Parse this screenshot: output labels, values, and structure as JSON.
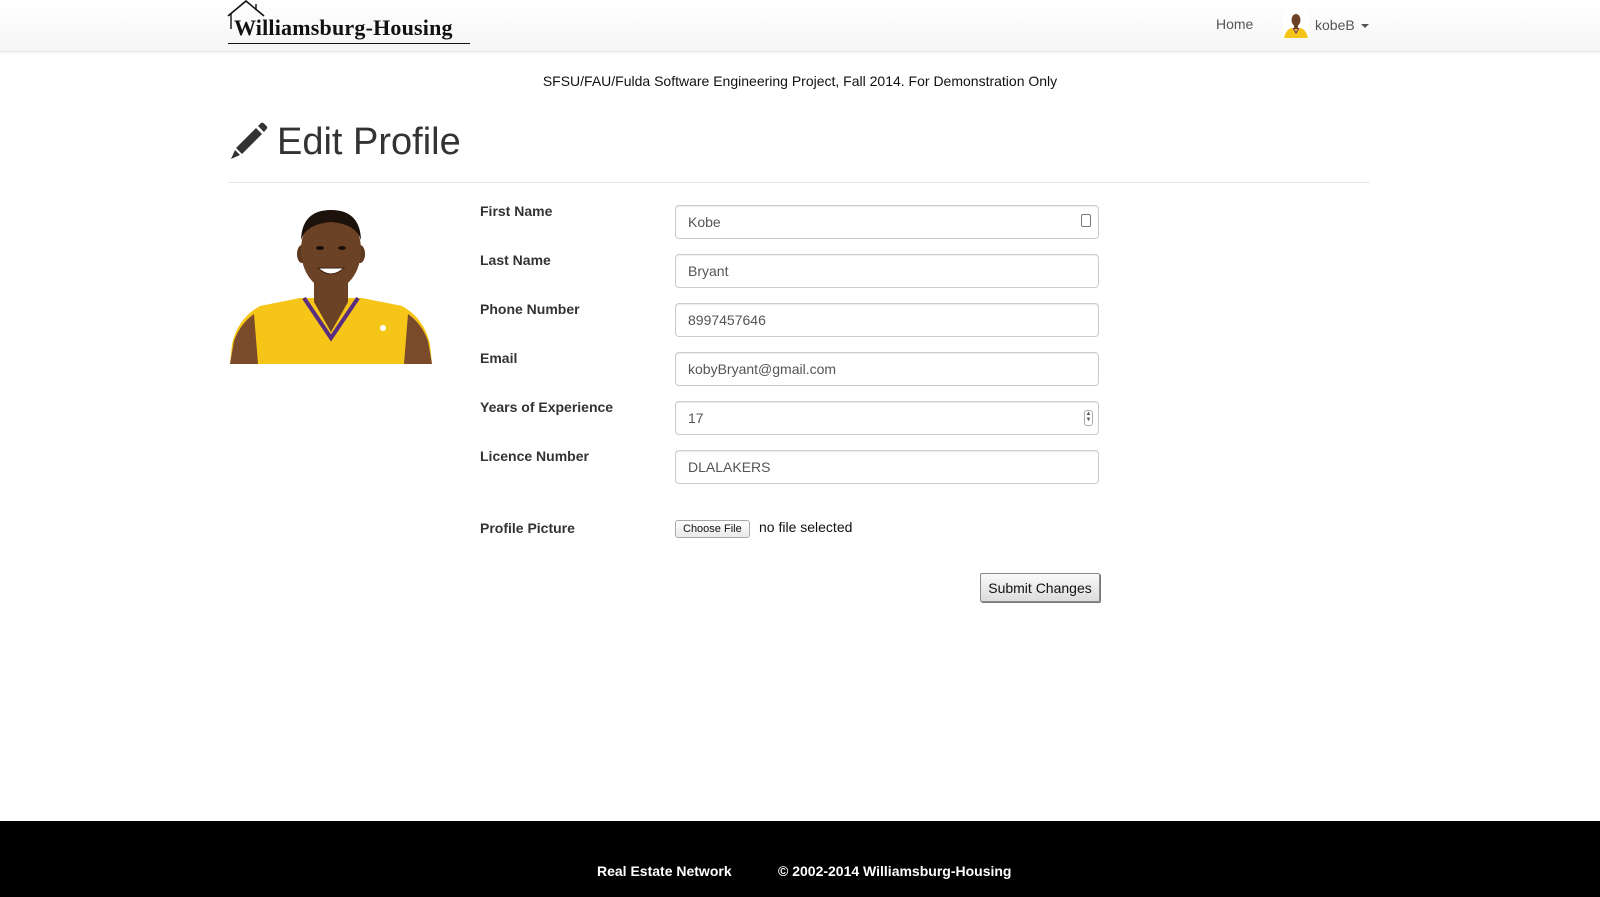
{
  "navbar": {
    "brand_text": "Williamsburg-Housing",
    "home_label": "Home",
    "user_label": "kobeB"
  },
  "disclaimer": "SFSU/FAU/Fulda Software Engineering Project, Fall 2014. For Demonstration Only",
  "page": {
    "title": "Edit Profile",
    "icon": "pencil-icon"
  },
  "form": {
    "first_name": {
      "label": "First Name",
      "value": "Kobe"
    },
    "last_name": {
      "label": "Last Name",
      "value": "Bryant"
    },
    "phone": {
      "label": "Phone Number",
      "value": "8997457646"
    },
    "email": {
      "label": "Email",
      "value": "kobyBryant@gmail.com"
    },
    "experience": {
      "label": "Years of Experience",
      "value": "17"
    },
    "licence": {
      "label": "Licence Number",
      "value": "DLALAKERS"
    },
    "picture": {
      "label": "Profile Picture",
      "button_label": "Choose File",
      "status": "no file selected"
    },
    "submit_label": "Submit Changes"
  },
  "footer": {
    "network": "Real Estate Network",
    "copyright": "© 2002-2014 Williamsburg-Housing"
  },
  "colors": {
    "jersey": "#f5c518",
    "jersey_trim": "#5a2d81",
    "skin": "#6b4226",
    "footer_bg": "#000000"
  }
}
